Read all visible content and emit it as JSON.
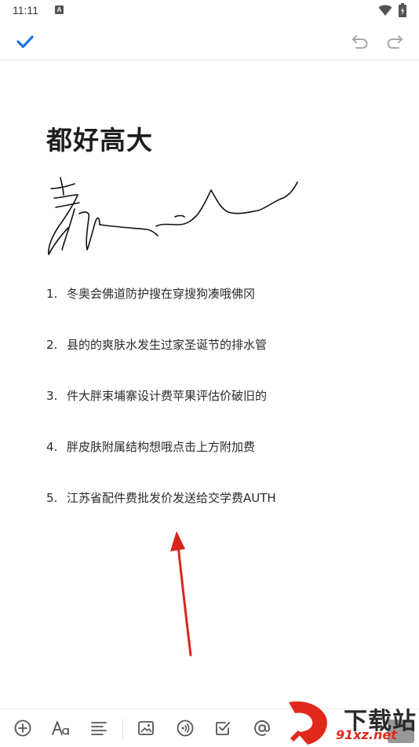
{
  "status_bar": {
    "time": "11:11",
    "notification_icon": "A"
  },
  "toolbar": {
    "confirm_icon": "check-icon",
    "undo_icon": "undo-icon",
    "redo_icon": "redo-icon"
  },
  "note": {
    "title": "都好高大",
    "list": [
      {
        "num": "1.",
        "text": "冬奥会佛道防护搜在穿搜狗凑哦佛冈"
      },
      {
        "num": "2.",
        "text": "县的的爽肤水发生过家圣诞节的排水管"
      },
      {
        "num": "3.",
        "text": "件大胖束埔寨设计费苹果评估价破旧的"
      },
      {
        "num": "4.",
        "text": "胖皮肤附属结构想哦点击上方附加费"
      },
      {
        "num": "5.",
        "text": "江苏省配件费批发价发送给交学费AUTH"
      }
    ]
  },
  "bottom_bar": {
    "items": [
      "add-icon",
      "text-format-icon",
      "align-icon",
      "image-icon",
      "audio-icon",
      "checkbox-icon",
      "mention-icon"
    ]
  },
  "watermark": {
    "brand": "下载站",
    "url": "91xz.net"
  },
  "colors": {
    "accent": "#1a73e8",
    "arrow": "#d9261c",
    "icon": "#555555"
  }
}
